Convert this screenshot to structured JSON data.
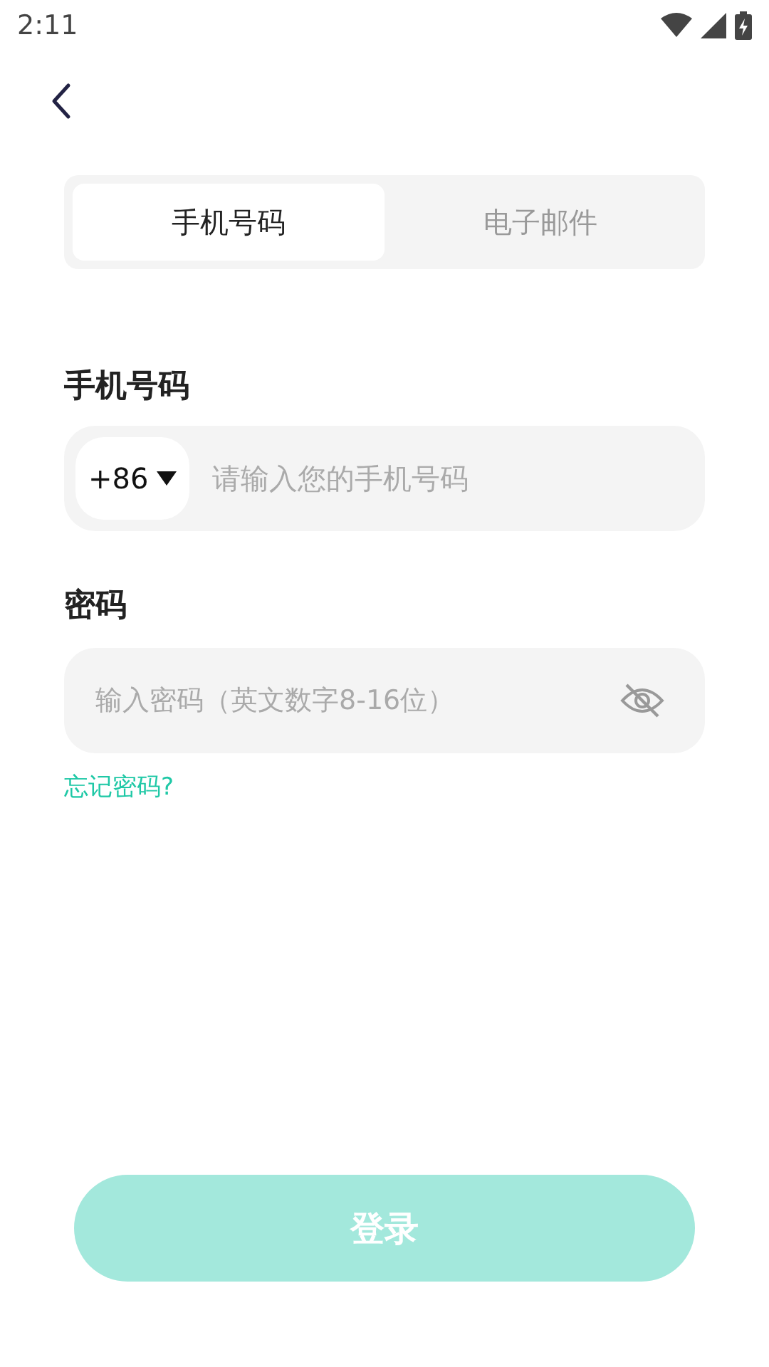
{
  "status_bar": {
    "time": "2:11"
  },
  "tabs": [
    {
      "label": "手机号码",
      "selected": true
    },
    {
      "label": "电子邮件",
      "selected": false
    }
  ],
  "phone": {
    "label": "手机号码",
    "country_code": "+86",
    "placeholder": "请输入您的手机号码"
  },
  "password": {
    "label": "密码",
    "placeholder": "输入密码（英文数字8-16位）",
    "visible": false
  },
  "forgot_link": "忘记密码?",
  "login_button": {
    "label": "登录",
    "disabled": true
  }
}
